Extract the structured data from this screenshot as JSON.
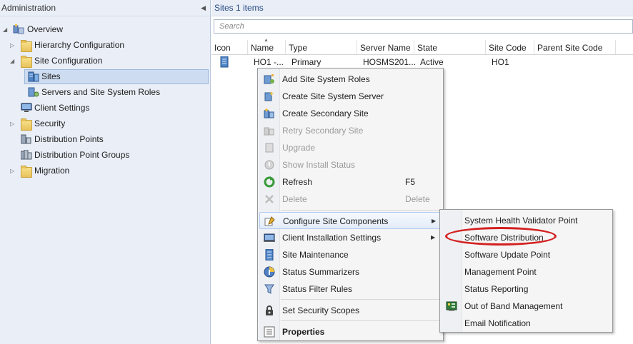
{
  "nav": {
    "title": "Administration",
    "items": [
      {
        "label": "Overview",
        "icon": "overview-icon",
        "level": 0,
        "expander": "expanded"
      },
      {
        "label": "Hierarchy Configuration",
        "icon": "folder-icon",
        "level": 1,
        "expander": "collapsed"
      },
      {
        "label": "Site Configuration",
        "icon": "folder-icon",
        "level": 1,
        "expander": "expanded"
      },
      {
        "label": "Sites",
        "icon": "sites-icon",
        "level": 2,
        "selected": true
      },
      {
        "label": "Servers and Site System Roles",
        "icon": "servers-icon",
        "level": 2
      },
      {
        "label": "Client Settings",
        "icon": "client-settings-icon",
        "level": 1
      },
      {
        "label": "Security",
        "icon": "folder-icon",
        "level": 1,
        "expander": "collapsed"
      },
      {
        "label": "Distribution Points",
        "icon": "distribution-points-icon",
        "level": 1
      },
      {
        "label": "Distribution Point Groups",
        "icon": "distribution-point-groups-icon",
        "level": 1
      },
      {
        "label": "Migration",
        "icon": "folder-icon",
        "level": 1,
        "expander": "collapsed"
      }
    ]
  },
  "main": {
    "title": "Sites 1 items",
    "search_placeholder": "Search",
    "columns": [
      "Icon",
      "Name",
      "Type",
      "Server Name",
      "State",
      "Site Code",
      "Parent Site Code"
    ],
    "rows": [
      {
        "name": "HO1 -...",
        "type": "Primary",
        "server": "HOSMS201...",
        "state": "Active",
        "site_code": "HO1",
        "parent": ""
      }
    ]
  },
  "context_menu": {
    "items": [
      {
        "label": "Add Site System Roles",
        "icon": "add-roles-icon"
      },
      {
        "label": "Create Site System Server",
        "icon": "create-server-icon"
      },
      {
        "label": "Create Secondary Site",
        "icon": "create-secondary-site-icon"
      },
      {
        "label": "Retry Secondary Site",
        "icon": "retry-secondary-site-icon",
        "disabled": true
      },
      {
        "label": "Upgrade",
        "icon": "upgrade-icon",
        "disabled": true
      },
      {
        "label": "Show Install Status",
        "icon": "install-status-icon",
        "disabled": true
      },
      {
        "label": "Refresh",
        "icon": "refresh-icon",
        "shortcut": "F5"
      },
      {
        "label": "Delete",
        "icon": "delete-icon",
        "shortcut": "Delete",
        "disabled": true
      },
      {
        "label": "Configure Site Components",
        "icon": "configure-components-icon",
        "submenu": true,
        "hover": true
      },
      {
        "label": "Client Installation Settings",
        "icon": "client-install-icon",
        "submenu": true
      },
      {
        "label": "Site Maintenance",
        "icon": "site-maintenance-icon"
      },
      {
        "label": "Status Summarizers",
        "icon": "status-summarizers-icon"
      },
      {
        "label": "Status Filter Rules",
        "icon": "status-filter-icon"
      },
      {
        "label": "Set Security Scopes",
        "icon": "security-scopes-icon"
      },
      {
        "label": "Properties",
        "icon": "properties-icon",
        "bold": true
      }
    ]
  },
  "submenu": {
    "items": [
      {
        "label": "System Health Validator Point"
      },
      {
        "label": "Software Distribution",
        "highlighted": true
      },
      {
        "label": "Software Update Point"
      },
      {
        "label": "Management Point"
      },
      {
        "label": "Status Reporting"
      },
      {
        "label": "Out of Band Management",
        "icon": "out-of-band-icon"
      },
      {
        "label": "Email Notification"
      }
    ]
  },
  "colors": {
    "nav_bg": "#e9eef7",
    "selection": "#cddcf1",
    "annotation": "#d42020",
    "title_text": "#2a4d84"
  }
}
